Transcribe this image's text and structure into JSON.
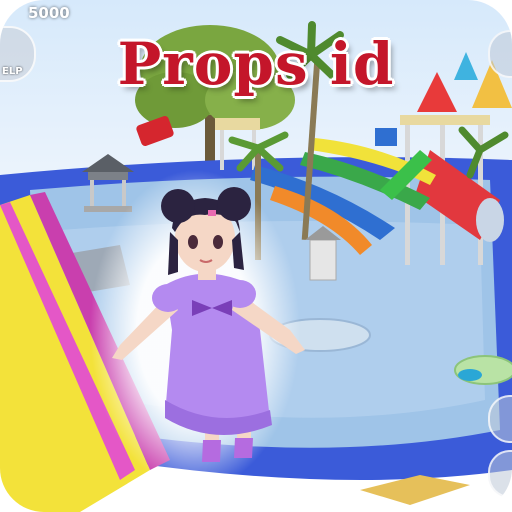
{
  "title": "Props id",
  "hud": {
    "money": "5000",
    "help_label": "ELP"
  },
  "colors": {
    "title_red": "#c4162a",
    "water": "#9fc4e8",
    "pool_rim": "#3b5bd9",
    "slide_yellow": "#f3e23a",
    "slide_pink": "#e457c7",
    "dress_purple": "#b48af0"
  },
  "icons": [
    "help-icon",
    "camera-icon",
    "jump-icon"
  ]
}
